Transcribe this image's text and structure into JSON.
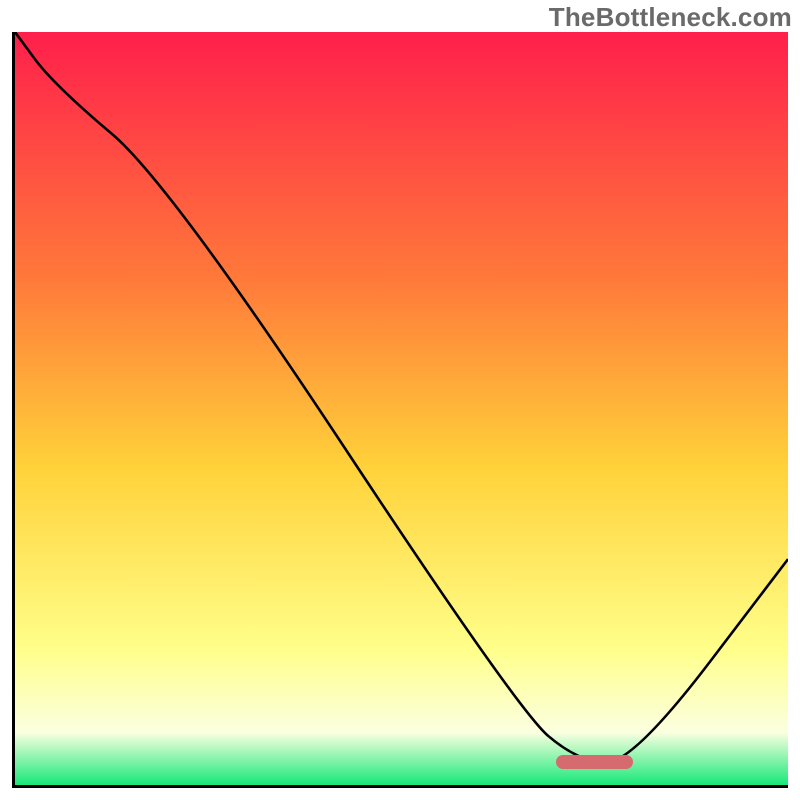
{
  "watermark": "TheBottleneck.com",
  "colors": {
    "gradient_top": "#ff1f4b",
    "gradient_mid_upper": "#ff7a3a",
    "gradient_mid": "#ffd23a",
    "gradient_lower": "#ffff8a",
    "gradient_pale": "#fbffe0",
    "gradient_bottom": "#17e879",
    "axis": "#000000",
    "curve": "#000000",
    "marker": "#d56a6f",
    "watermark_text": "#6a6a6a"
  },
  "chart_data": {
    "type": "line",
    "title": "",
    "xlabel": "",
    "ylabel": "",
    "xlim": [
      0,
      100
    ],
    "ylim": [
      0,
      100
    ],
    "grid": false,
    "legend": false,
    "x": [
      0,
      5,
      20,
      65,
      73,
      80,
      100
    ],
    "values": [
      100,
      93,
      80,
      10,
      3,
      3,
      30
    ],
    "marker_range_x": [
      70,
      80
    ],
    "marker_y": 3
  }
}
